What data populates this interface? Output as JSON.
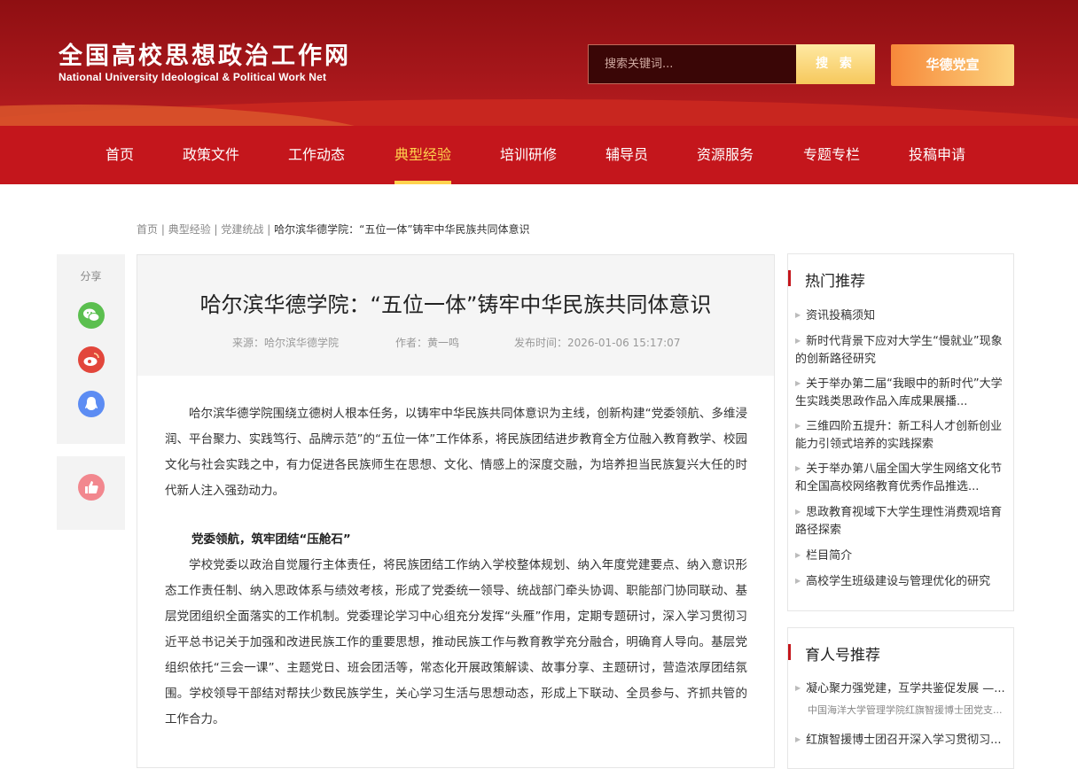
{
  "header": {
    "logo_cn": "全国高校思想政治工作网",
    "logo_en": "National University Ideological & Political Work Net",
    "search_placeholder": "搜索关键词...",
    "search_button": "搜 索",
    "right_button": "华德党宣"
  },
  "nav": {
    "items": [
      "首页",
      "政策文件",
      "工作动态",
      "典型经验",
      "培训研修",
      "辅导员",
      "资源服务",
      "专题专栏",
      "投稿申请"
    ],
    "active": "典型经验"
  },
  "breadcrumb": {
    "crumbs": [
      "首页",
      "典型经验",
      "党建统战"
    ],
    "current": "哈尔滨华德学院：“五位一体”铸牢中华民族共同体意识"
  },
  "share": {
    "title": "分享",
    "icons": [
      "wechat-icon",
      "weibo-icon",
      "qq-icon"
    ],
    "like_icon": "thumbs-up-icon"
  },
  "article": {
    "title": "哈尔滨华德学院：“五位一体”铸牢中华民族共同体意识",
    "source": "来源：哈尔滨华德学院",
    "author": "作者：黄一鸣",
    "date": "发布时间：2026-01-06 15:17:07",
    "paragraph1": "哈尔滨华德学院围绕立德树人根本任务，以铸牢中华民族共同体意识为主线，创新构建“党委领航、多维浸润、平台聚力、实践笃行、品牌示范”的“五位一体”工作体系，将民族团结进步教育全方位融入教育教学、校园文化与社会实践之中，有力促进各民族师生在思想、文化、情感上的深度交融，为培养担当民族复兴大任的时代新人注入强劲动力。",
    "subhead1": "党委领航，筑牢团结“压舱石”",
    "paragraph2": "学校党委以政治自觉履行主体责任，将民族团结工作纳入学校整体规划、纳入年度党建要点、纳入意识形态工作责任制、纳入思政体系与绩效考核，形成了党委统一领导、统战部门牵头协调、职能部门协同联动、基层党团组织全面落实的工作机制。党委理论学习中心组充分发挥“头雁”作用，定期专题研讨，深入学习贯彻习近平总书记关于加强和改进民族工作的重要思想，推动民族工作与教育教学充分融合，明确育人导向。基层党组织依托“三会一课”、主题党日、班会团活等，常态化开展政策解读、故事分享、主题研讨，营造浓厚团结氛围。学校领导干部结对帮扶少数民族学生，关心学习生活与思想动态，形成上下联动、全员参与、齐抓共管的工作合力。"
  },
  "sidebar": {
    "hot_title": "热门推荐",
    "hot_items": [
      "资讯投稿须知",
      "新时代背景下应对大学生“慢就业”现象的创新路径研究",
      "关于举办第二届“我眼中的新时代”大学生实践类思政作品入库成果展播...",
      "三维四阶五提升：新工科人才创新创业能力引领式培养的实践探索",
      "关于举办第八届全国大学生网络文化节和全国高校网络教育优秀作品推选...",
      "思政教育视域下大学生理性消费观培育路径探索",
      "栏目简介",
      "高校学生班级建设与管理优化的研究"
    ],
    "yuren_title": "育人号推荐",
    "yuren_items": [
      {
        "title": "凝心聚力强党建，互学共鉴促发展 —...",
        "sub": "中国海洋大学管理学院红旗智援博士团党支..."
      },
      {
        "title": "红旗智援博士团召开深入学习贯彻习...",
        "sub": ""
      }
    ]
  },
  "colors": {
    "brand_red": "#c4161c",
    "nav_active": "#ffd34e",
    "wechat": "#5bbf4f",
    "weibo": "#e2463b",
    "qq": "#5c8cf3",
    "like": "#f2878e"
  }
}
